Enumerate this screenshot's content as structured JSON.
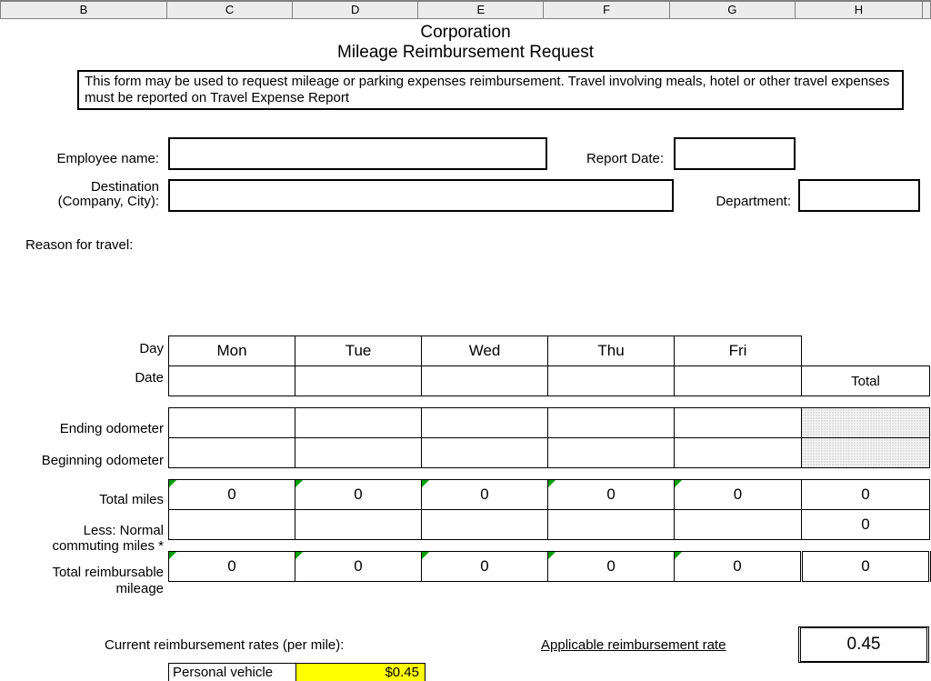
{
  "columns": [
    "B",
    "C",
    "D",
    "E",
    "F",
    "G",
    "H"
  ],
  "title": "Corporation",
  "subtitle": "Mileage Reimbursement Request",
  "instructions": "This form may be used to request mileage or parking expenses reimbursement.  Travel involving meals, hotel or other travel expenses must be reported on Travel Expense Report",
  "labels": {
    "employee_name": "Employee name:",
    "report_date": "Report Date:",
    "destination1": "Destination",
    "destination2": "(Company, City):",
    "department": "Department:",
    "reason": "Reason for travel:",
    "day": "Day",
    "date": "Date",
    "total_hdr": "Total",
    "ending": "Ending odometer",
    "beginning": "Beginning odometer",
    "total_miles": "Total miles",
    "less_normal1": "Less: Normal",
    "less_normal2": "commuting miles *",
    "total_reimb1": "Total reimbursable",
    "total_reimb2": "mileage",
    "rates": "Current reimbursement rates (per mile):",
    "applicable": "Applicable reimbursement rate",
    "personal_vehicle": "Personal vehicle"
  },
  "days": [
    "Mon",
    "Tue",
    "Wed",
    "Thu",
    "Fri"
  ],
  "total_miles": [
    "0",
    "0",
    "0",
    "0",
    "0",
    "0"
  ],
  "commuting_total": "0",
  "reimbursable": [
    "0",
    "0",
    "0",
    "0",
    "0",
    "0"
  ],
  "applicable_rate": "0.45",
  "personal_vehicle_rate": "$0.45",
  "chart_data": {
    "type": "table",
    "title": "Mileage Reimbursement Request",
    "columns": [
      "Mon",
      "Tue",
      "Wed",
      "Thu",
      "Fri",
      "Total"
    ],
    "rows": [
      {
        "label": "Ending odometer",
        "values": [
          "",
          "",
          "",
          "",
          "",
          ""
        ]
      },
      {
        "label": "Beginning odometer",
        "values": [
          "",
          "",
          "",
          "",
          "",
          ""
        ]
      },
      {
        "label": "Total miles",
        "values": [
          0,
          0,
          0,
          0,
          0,
          0
        ]
      },
      {
        "label": "Less: Normal commuting miles *",
        "values": [
          "",
          "",
          "",
          "",
          "",
          0
        ]
      },
      {
        "label": "Total reimbursable mileage",
        "values": [
          0,
          0,
          0,
          0,
          0,
          0
        ]
      }
    ],
    "applicable_reimbursement_rate": 0.45,
    "personal_vehicle_rate_usd": 0.45
  }
}
